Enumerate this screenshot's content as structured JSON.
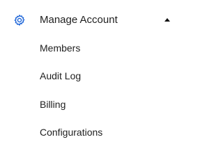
{
  "menu": {
    "header": {
      "label": "Manage Account",
      "icon": "gear-icon",
      "caret_icon": "caret-up-icon",
      "accent_color": "#1a63d8"
    },
    "items": [
      {
        "label": "Members"
      },
      {
        "label": "Audit Log"
      },
      {
        "label": "Billing"
      },
      {
        "label": "Configurations"
      }
    ]
  }
}
